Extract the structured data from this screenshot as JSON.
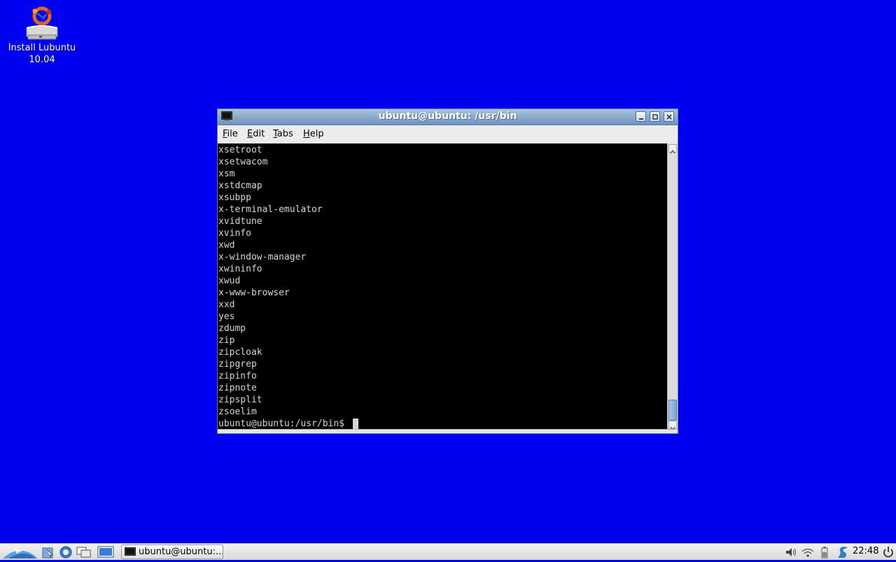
{
  "desktop": {
    "icon_label_line1": "Install Lubuntu",
    "icon_label_line2": "10.04",
    "background_color": "#0000f0"
  },
  "window": {
    "title": "ubuntu@ubuntu: /usr/bin",
    "menu": [
      {
        "mnemonic": "F",
        "rest": "ile"
      },
      {
        "mnemonic": "E",
        "rest": "dit"
      },
      {
        "mnemonic": "T",
        "rest": "abs"
      },
      {
        "mnemonic": "H",
        "rest": "elp"
      }
    ],
    "terminal_lines": [
      "xsetroot",
      "xsetwacom",
      "xsm",
      "xstdcmap",
      "xsubpp",
      "x-terminal-emulator",
      "xvidtune",
      "xvinfo",
      "xwd",
      "x-window-manager",
      "xwininfo",
      "xwud",
      "x-www-browser",
      "xxd",
      "yes",
      "zdump",
      "zip",
      "zipcloak",
      "zipgrep",
      "zipinfo",
      "zipnote",
      "zipsplit",
      "zsoelim"
    ],
    "prompt": "ubuntu@ubuntu:/usr/bin$ "
  },
  "taskbar": {
    "task_label": "ubuntu@ubuntu:...",
    "clock": "22:48",
    "launchers": [
      "lubuntu-menu-icon",
      "file-manager-icon",
      "web-browser-icon",
      "switch-windows-icon",
      "desktop-icon"
    ],
    "tray_icons": [
      "volume-icon",
      "wifi-icon",
      "battery-icon",
      "network-manager-icon",
      "power-icon"
    ]
  }
}
